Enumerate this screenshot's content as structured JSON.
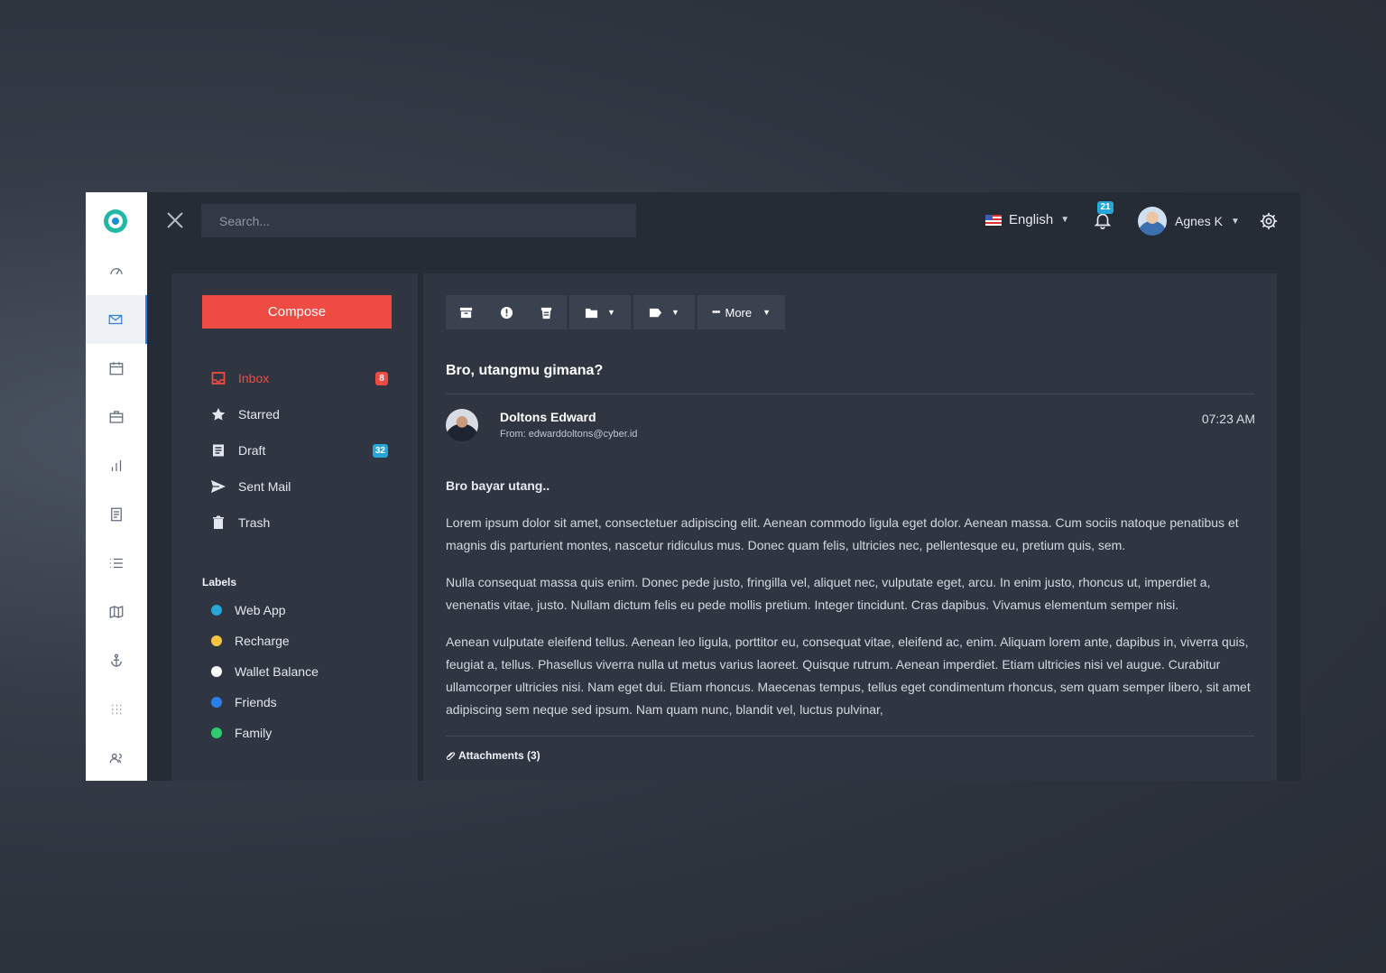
{
  "search": {
    "placeholder": "Search..."
  },
  "topbar": {
    "language": "English",
    "notifications": "21",
    "user_name": "Agnes K"
  },
  "sidebar": {
    "items": [
      "dashboard",
      "mail",
      "calendar",
      "briefcase",
      "chart",
      "document",
      "list",
      "map",
      "anchor",
      "apps",
      "users"
    ]
  },
  "mailnav": {
    "compose": "Compose",
    "folders": [
      {
        "label": "Inbox",
        "count": "8",
        "count_color": "#f04b43"
      },
      {
        "label": "Starred",
        "count": ""
      },
      {
        "label": "Draft",
        "count": "32",
        "count_color": "#27a6d8"
      },
      {
        "label": "Sent Mail",
        "count": ""
      },
      {
        "label": "Trash",
        "count": ""
      }
    ],
    "labels_title": "Labels",
    "labels": [
      {
        "label": "Web App",
        "color": "#27a6d8"
      },
      {
        "label": "Recharge",
        "color": "#f5c242"
      },
      {
        "label": "Wallet Balance",
        "color": "#ffffff"
      },
      {
        "label": "Friends",
        "color": "#2b7de9"
      },
      {
        "label": "Family",
        "color": "#2ecc71"
      }
    ]
  },
  "toolbar": {
    "more_label": "More"
  },
  "message": {
    "subject": "Bro, utangmu gimana?",
    "sender_name": "Doltons Edward",
    "sender_from": "From: edwarddoltons@cyber.id",
    "time": "07:23 AM",
    "greeting": "Bro bayar utang..",
    "paragraphs": [
      "Lorem ipsum dolor sit amet, consectetuer adipiscing elit. Aenean commodo ligula eget dolor. Aenean massa. Cum sociis natoque penatibus et magnis dis parturient montes, nascetur ridiculus mus. Donec quam felis, ultricies nec, pellentesque eu, pretium quis, sem.",
      "Nulla consequat massa quis enim. Donec pede justo, fringilla vel, aliquet nec, vulputate eget, arcu. In enim justo, rhoncus ut, imperdiet a, venenatis vitae, justo. Nullam dictum felis eu pede mollis pretium. Integer tincidunt. Cras dapibus. Vivamus elementum semper nisi.",
      "Aenean vulputate eleifend tellus. Aenean leo ligula, porttitor eu, consequat vitae, eleifend ac, enim. Aliquam lorem ante, dapibus in, viverra quis, feugiat a, tellus. Phasellus viverra nulla ut metus varius laoreet. Quisque rutrum. Aenean imperdiet. Etiam ultricies nisi vel augue. Curabitur ullamcorper ultricies nisi. Nam eget dui. Etiam rhoncus. Maecenas tempus, tellus eget condimentum rhoncus, sem quam semper libero, sit amet adipiscing sem neque sed ipsum. Nam quam nunc, blandit vel, luctus pulvinar,"
    ],
    "attachments": "Attachments (3)"
  }
}
